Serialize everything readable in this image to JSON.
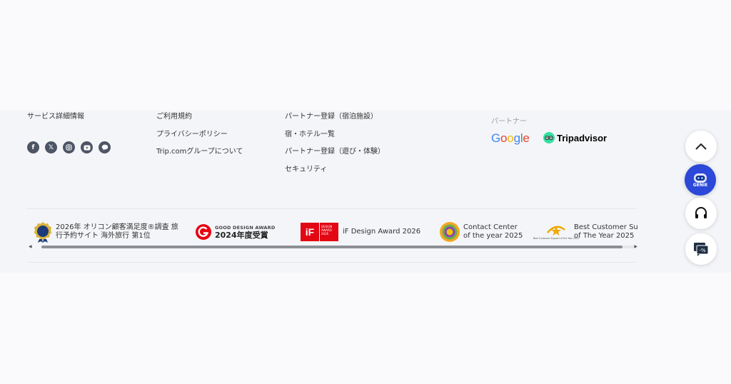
{
  "footer": {
    "col1": {
      "title": "サービス詳細情報"
    },
    "col2": {
      "links": [
        "ご利用規約",
        "プライバシーポリシー",
        "Trip.comグループについて"
      ]
    },
    "col3": {
      "links": [
        "パートナー登録（宿泊施設）",
        "宿・ホテル一覧",
        "パートナー登録（遊び・体験）",
        "セキュリティ"
      ]
    },
    "partners": {
      "label": "パートナー",
      "google": "Google",
      "tripadvisor": "Tripadvisor"
    },
    "social": [
      "facebook-icon",
      "x-icon",
      "instagram-icon",
      "youtube-icon",
      "line-icon"
    ]
  },
  "awards": {
    "oricon": {
      "line1": "2026年 オリコン顧客満足度®調査 旅",
      "line2": "行予約サイト 海外旅行 第1位"
    },
    "gooddesign": {
      "line1": "GOOD DESIGN AWARD",
      "line2": "2024年度受賞"
    },
    "ifdesign": {
      "badge": "DESIGN AWARD 2026",
      "text": "iF Design Award 2026"
    },
    "contact": {
      "line1": "Contact Center",
      "line2": "of the year 2025"
    },
    "support": {
      "line1": "Best Customer Supp",
      "line2": "of The Year 2025",
      "badge": "Best Customer Support of the Year 2025"
    }
  },
  "floating": {
    "genie_label": "GENIE"
  },
  "colors": {
    "genie": "#2b48d8",
    "tripadvisor": "#34e0a1",
    "gooddesign": "#e60012",
    "ifdesign": "#e30613"
  }
}
